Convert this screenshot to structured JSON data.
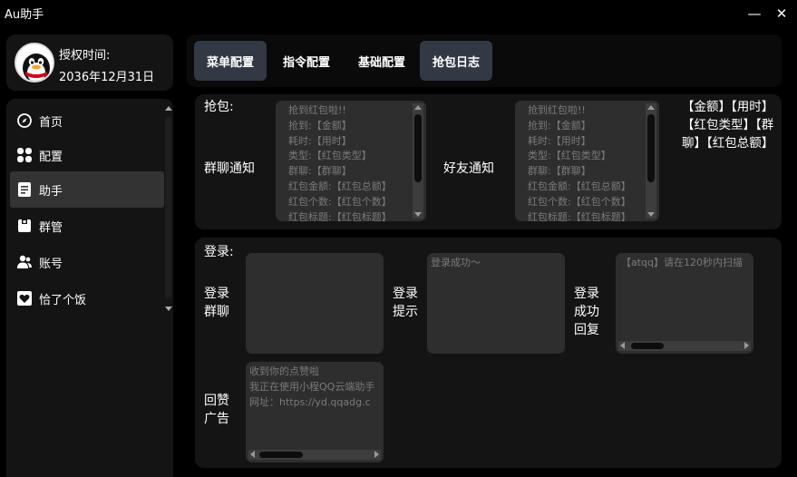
{
  "window": {
    "title": "Au助手",
    "minimize_symbol": "—",
    "close_symbol": "✕"
  },
  "profile": {
    "auth_label": "授权时间:",
    "auth_date": "2036年12月31日",
    "avatar_icon": "qq-penguin-icon"
  },
  "sidebar": {
    "items": [
      {
        "label": "首页",
        "icon": "compass-icon",
        "active": false
      },
      {
        "label": "配置",
        "icon": "grid-icon",
        "active": false
      },
      {
        "label": "助手",
        "icon": "document-icon",
        "active": true
      },
      {
        "label": "群管",
        "icon": "folder-icon",
        "active": false
      },
      {
        "label": "账号",
        "icon": "users-icon",
        "active": false
      },
      {
        "label": "恰了个饭",
        "icon": "heart-icon",
        "active": false
      }
    ]
  },
  "tabs": [
    {
      "label": "菜单配置",
      "active": true
    },
    {
      "label": "指令配置",
      "active": false
    },
    {
      "label": "基础配置",
      "active": false
    },
    {
      "label": "抢包日志",
      "active": true
    }
  ],
  "rob_section": {
    "title": "抢包:",
    "group_label": "群聊通知",
    "friend_label": "好友通知",
    "group_text": "抢到红包啦!!\n抢到:【金额】\n耗时:【用时】\n类型:【红包类型】\n群聊:【群聊】\n红包金额:【红包总额】\n红包个数:【红包个数】\n红包标题:【红包标题】",
    "friend_text": "抢到红包啦!!\n抢到:【金额】\n耗时:【用时】\n类型:【红包类型】\n群聊:【群聊】\n红包金额:【红包总额】\n红包个数:【红包个数】\n红包标题:【红包标题】",
    "variables_hint": "【金额】【用时】【红包类型】【群聊】【红包总额】"
  },
  "login_section": {
    "title": "登录:",
    "group_label": "登录\n群聊",
    "prompt_label": "登录\n提示",
    "reply_label": "登录\n成功\n回复",
    "like_label": "回赞\n广告",
    "group_value": "",
    "prompt_value": "登录成功～",
    "reply_value": "【atqq】请在120秒内扫描",
    "like_value": "收到你的点赞啦\n我正在使用小程QQ云端助手\n网址：https://yd.qqadg.c"
  },
  "colors": {
    "background": "#000000",
    "panel": "#141414",
    "active_tab": "#333845",
    "active_nav": "#333333",
    "textbox": "#2e2e2e"
  }
}
